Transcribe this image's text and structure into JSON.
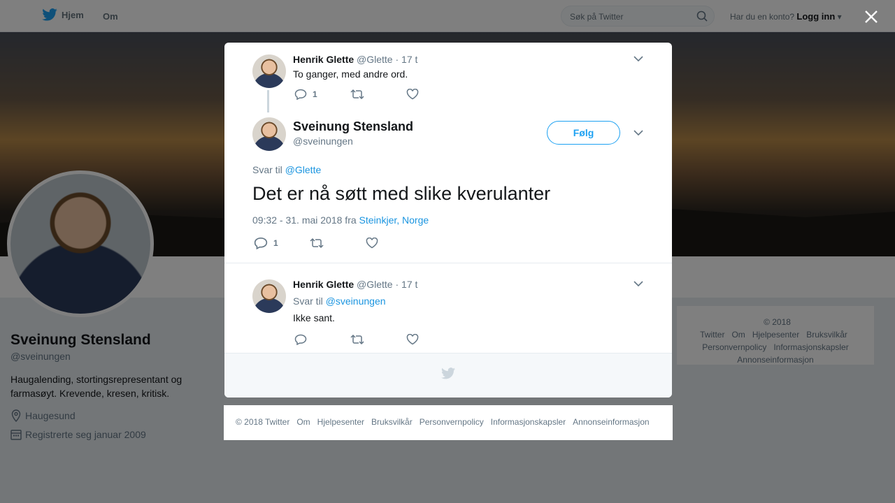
{
  "nav": {
    "home_label": "Hjem",
    "about_label": "Om",
    "search_placeholder": "Søk på Twitter",
    "account_prompt": "Har du en konto?",
    "login_label": "Logg inn"
  },
  "profile": {
    "name": "Sveinung Stensland",
    "handle": "@sveinungen",
    "bio": "Haugalending, stortingsrepresentant og farmasøyt. Krevende, kresen, kritisk.",
    "location": "Haugesund",
    "joined": "Registrerte seg januar 2009"
  },
  "side_footer": {
    "items": [
      "© 2018 Twitter",
      "Om",
      "Hjelpesenter",
      "Bruksvilkår",
      "Personvernpolicy",
      "Informasjonskapsler",
      "Annonseinformasjon"
    ]
  },
  "thread": {
    "parent": {
      "name": "Henrik Glette",
      "handle": "@Glette",
      "time": "· 17 t",
      "text": "To ganger, med andre ord.",
      "reply_count": "1"
    },
    "main": {
      "name": "Sveinung Stensland",
      "handle": "@sveinungen",
      "follow_label": "Følg",
      "reply_prefix": "Svar til",
      "reply_to": "@Glette",
      "text": "Det er nå søtt med slike kverulanter",
      "timestamp": "09:32 - 31. mai 2018 fra",
      "location": "Steinkjer, Norge",
      "reply_count": "1"
    },
    "reply": {
      "name": "Henrik Glette",
      "handle": "@Glette",
      "time": "· 17 t",
      "reply_prefix": "Svar til",
      "reply_to": "@sveinungen",
      "text": "Ikke sant."
    }
  },
  "bottom_footer": {
    "items": [
      "© 2018 Twitter",
      "Om",
      "Hjelpesenter",
      "Bruksvilkår",
      "Personvernpolicy",
      "Informasjonskapsler",
      "Annonseinformasjon"
    ]
  },
  "colors": {
    "accent": "#1da1f2",
    "link": "#1b95e0",
    "muted": "#657786"
  }
}
